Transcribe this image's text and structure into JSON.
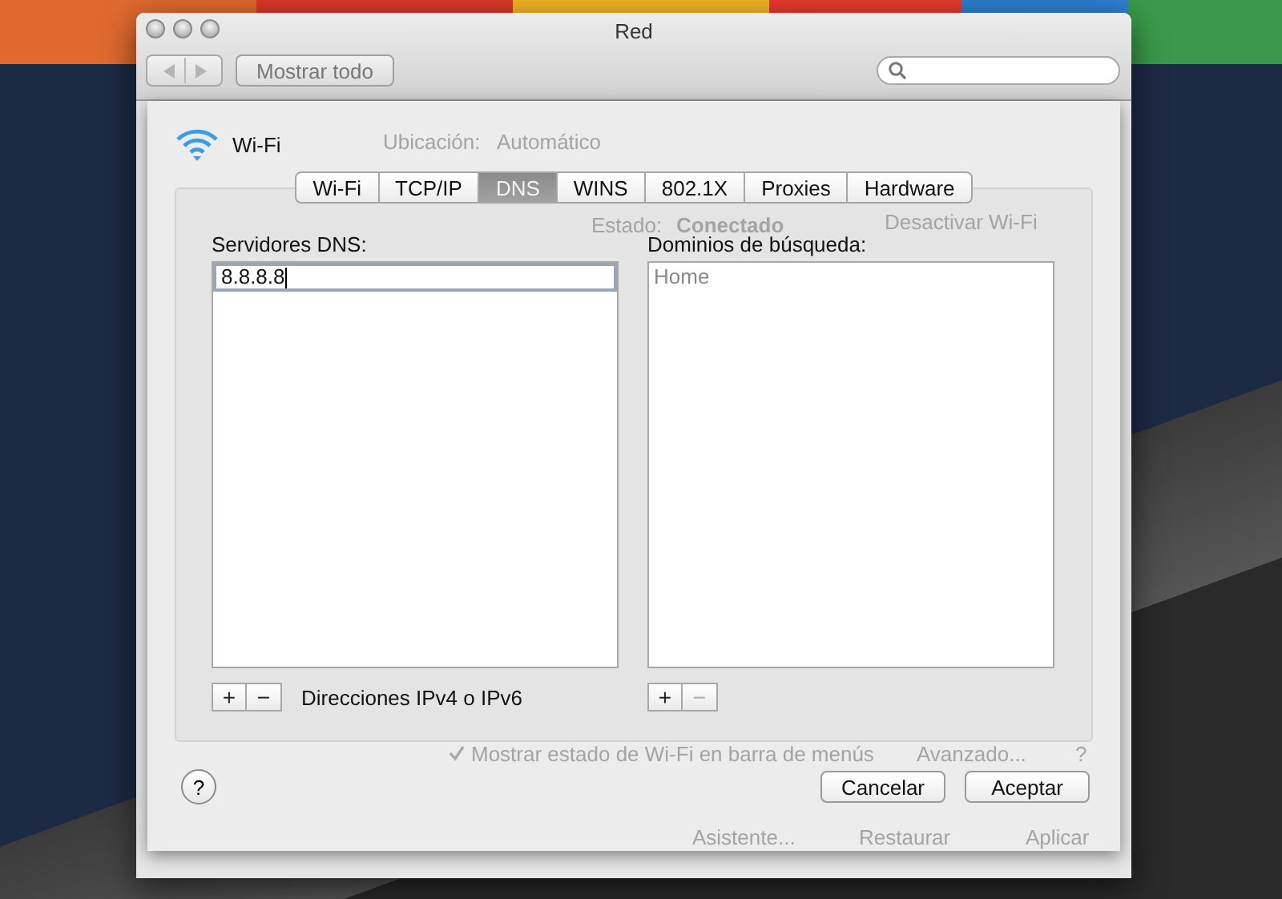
{
  "window": {
    "title": "Red",
    "show_all_button": "Mostrar todo"
  },
  "background_panel": {
    "location_label": "Ubicación:",
    "location_value": "Automático",
    "status_label": "Estado:",
    "status_value": "Conectado",
    "wifi_off_button": "Desactivar Wi-Fi",
    "show_status": {
      "label": "Mostrar estado de Wi-Fi en barra de menús",
      "checked": true
    },
    "advanced_button": "Avanzado...",
    "help_button": "?",
    "buttons": [
      "Asistente...",
      "Restaurar",
      "Aplicar"
    ]
  },
  "sheet": {
    "interface": "Wi-Fi",
    "tabs": [
      {
        "label": "Wi-Fi",
        "selected": false
      },
      {
        "label": "TCP/IP",
        "selected": false
      },
      {
        "label": "DNS",
        "selected": true
      },
      {
        "label": "WINS",
        "selected": false
      },
      {
        "label": "802.1X",
        "selected": false
      },
      {
        "label": "Proxies",
        "selected": false
      },
      {
        "label": "Hardware",
        "selected": false
      }
    ],
    "lists": [
      {
        "label": "Servidores DNS:",
        "entries": [
          {
            "text": "8.8.8.8",
            "editing": true
          }
        ],
        "add": "+",
        "remove": "−",
        "remove_disabled": false,
        "hint": "Direcciones IPv4 o IPv6"
      },
      {
        "label": "Dominios de búsqueda:",
        "entries": [
          {
            "text": "Home",
            "editing": false
          }
        ],
        "add": "+",
        "remove": "−",
        "remove_disabled": true
      }
    ],
    "help_button": "?",
    "buttons": [
      "Cancelar",
      "Aceptar"
    ]
  }
}
